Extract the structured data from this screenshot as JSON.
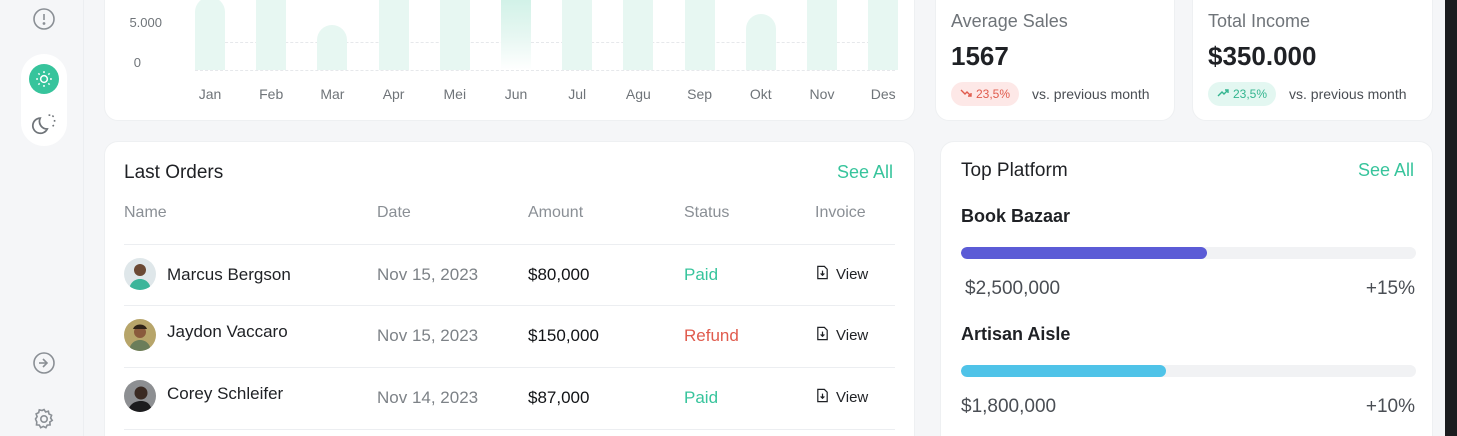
{
  "sidebar": {
    "icons": [
      "alert-circle-icon",
      "sun-icon",
      "moon-icon",
      "arrow-right-circle-icon",
      "gear-icon"
    ],
    "active_color": "#37c49c"
  },
  "chart_data": {
    "type": "bar",
    "categories": [
      "Jan",
      "Feb",
      "Mar",
      "Apr",
      "Mei",
      "Jun",
      "Jul",
      "Agu",
      "Sep",
      "Okt",
      "Nov",
      "Des"
    ],
    "values": [
      13000,
      15000,
      8000,
      15000,
      15000,
      20000,
      15000,
      15000,
      15000,
      10000,
      15000,
      15000
    ],
    "highlighted": "Jun",
    "y_ticks": [
      "5.000",
      "0"
    ],
    "ylim": [
      0,
      12000
    ],
    "grid": true,
    "color": "#e7f7f2"
  },
  "average_sales": {
    "title": "Average Sales",
    "value": "1567",
    "change": "23,5%",
    "direction": "down",
    "note": "vs. previous month"
  },
  "total_income": {
    "title": "Total Income",
    "value": "$350.000",
    "change": "23,5%",
    "direction": "up",
    "note": "vs. previous month"
  },
  "orders": {
    "title": "Last Orders",
    "see_all": "See All",
    "columns": [
      "Name",
      "Date",
      "Amount",
      "Status",
      "Invoice"
    ],
    "rows": [
      {
        "name": "Marcus Bergson",
        "date": "Nov 15, 2023",
        "amount": "$80,000",
        "status": "Paid",
        "invoice": "View"
      },
      {
        "name": "Jaydon Vaccaro",
        "date": "Nov 15, 2023",
        "amount": "$150,000",
        "status": "Refund",
        "invoice": "View"
      },
      {
        "name": "Corey Schleifer",
        "date": "Nov 14, 2023",
        "amount": "$87,000",
        "status": "Paid",
        "invoice": "View"
      }
    ]
  },
  "platforms": {
    "title": "Top Platform",
    "see_all": "See All",
    "items": [
      {
        "name": "Book Bazaar",
        "amount": "$2,500,000",
        "change": "+15%",
        "progress": 0.54,
        "color": "#5b5bd6"
      },
      {
        "name": "Artisan Aisle",
        "amount": "$1,800,000",
        "change": "+10%",
        "progress": 0.45,
        "color": "#4fc3e8"
      }
    ]
  }
}
